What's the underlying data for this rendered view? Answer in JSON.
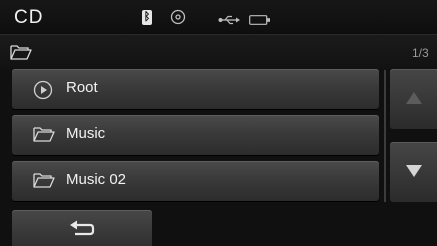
{
  "status": {
    "title": "CD",
    "icons": [
      "bluetooth-icon",
      "disc-icon",
      "usb-icon",
      "battery-icon"
    ]
  },
  "path": {
    "icon": "folder-icon",
    "page_count": "1/3"
  },
  "list": {
    "items": [
      {
        "label": "Root",
        "icon": "play-circle-icon"
      },
      {
        "label": "Music",
        "icon": "folder-icon"
      },
      {
        "label": "Music 02",
        "icon": "folder-icon"
      }
    ]
  },
  "controls": {
    "scroll_up_icon": "triangle-up-icon",
    "scroll_down_icon": "triangle-down-icon",
    "back_icon": "back-arrow-icon"
  },
  "colors": {
    "background": "#101010",
    "button": "#3a3a3a",
    "text": "#f2f2f2"
  }
}
